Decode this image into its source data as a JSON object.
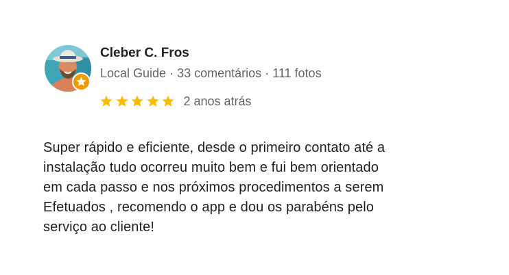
{
  "review": {
    "author": {
      "name": "Cleber C. Fros",
      "role": "Local Guide",
      "separator": "·",
      "reviews_count": "33 comentários",
      "photos_count": "111 fotos",
      "avatar_icon": "user-avatar-photo",
      "badge_icon": "local-guide-star-badge"
    },
    "rating": {
      "stars": 5,
      "max": 5,
      "star_color": "#fbbc04",
      "date": "2 anos atrás"
    },
    "text_lines": [
      "Super rápido e eficiente, desde o primeiro contato até a",
      "instalação tudo ocorreu muito bem e fui bem orientado",
      "em cada passo e nos próximos procedimentos a serem",
      "Efetuados , recomendo o app e dou os parabéns pelo",
      "serviço ao cliente!"
    ],
    "colors": {
      "name": "#202124",
      "meta": "#5f6368",
      "badge": "#f29900"
    }
  }
}
